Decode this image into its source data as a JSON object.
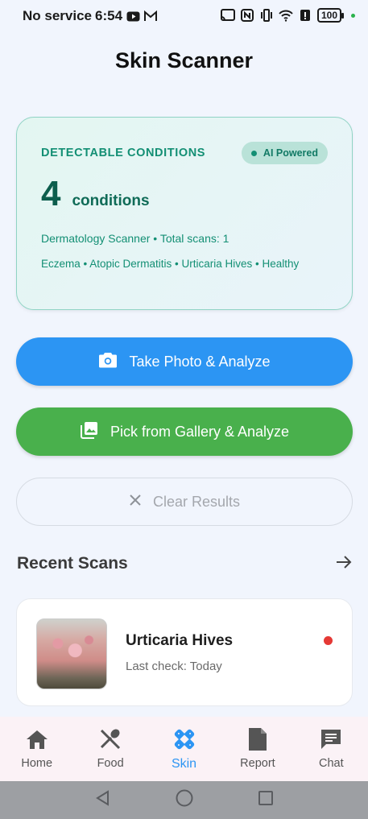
{
  "status_bar": {
    "carrier": "No service",
    "time": "6:54",
    "battery": "100"
  },
  "header": {
    "title": "Skin Scanner"
  },
  "conditions_card": {
    "label": "DETECTABLE CONDITIONS",
    "badge": "AI Powered",
    "count": "4",
    "count_unit": "conditions",
    "meta": "Dermatology Scanner • Total scans: 1",
    "list": "Eczema • Atopic Dermatitis • Urticaria Hives • Healthy"
  },
  "actions": {
    "photo_label": "Take Photo & Analyze",
    "gallery_label": "Pick from Gallery & Analyze",
    "clear_label": "Clear Results"
  },
  "recent": {
    "title": "Recent Scans",
    "items": [
      {
        "name": "Urticaria Hives",
        "subtitle": "Last check: Today",
        "status_color": "#e53935"
      }
    ]
  },
  "bottom_nav": {
    "items": [
      {
        "label": "Home",
        "icon": "home-icon"
      },
      {
        "label": "Food",
        "icon": "food-icon"
      },
      {
        "label": "Skin",
        "icon": "skin-icon",
        "active": true
      },
      {
        "label": "Report",
        "icon": "report-icon"
      },
      {
        "label": "Chat",
        "icon": "chat-icon"
      }
    ]
  },
  "colors": {
    "primary_blue": "#2c95f3",
    "gallery_green": "#49b04c",
    "teal_accent": "#138f74",
    "status_red": "#e53935"
  }
}
